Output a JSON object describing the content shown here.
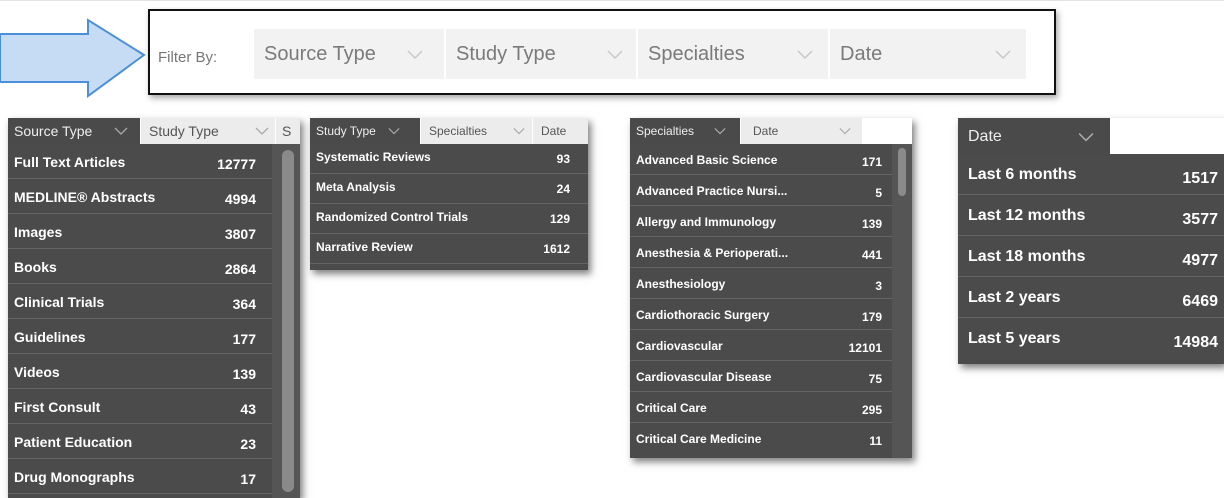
{
  "filter_bar": {
    "label": "Filter By:",
    "dropdowns": [
      {
        "label": "Source Type"
      },
      {
        "label": "Study Type"
      },
      {
        "label": "Specialties"
      },
      {
        "label": "Date"
      }
    ]
  },
  "source_panel": {
    "tabs": [
      "Source Type",
      "Study Type",
      "S"
    ],
    "items": [
      {
        "label": "Full Text Articles",
        "count": "12777"
      },
      {
        "label": "MEDLINE® Abstracts",
        "count": "4994"
      },
      {
        "label": "Images",
        "count": "3807"
      },
      {
        "label": "Books",
        "count": "2864"
      },
      {
        "label": "Clinical Trials",
        "count": "364"
      },
      {
        "label": "Guidelines",
        "count": "177"
      },
      {
        "label": "Videos",
        "count": "139"
      },
      {
        "label": "First Consult",
        "count": "43"
      },
      {
        "label": "Patient Education",
        "count": "23"
      },
      {
        "label": "Drug Monographs",
        "count": "17"
      }
    ]
  },
  "study_panel": {
    "tabs": [
      "Study Type",
      "Specialties",
      "Date"
    ],
    "items": [
      {
        "label": "Systematic Reviews",
        "count": "93"
      },
      {
        "label": "Meta Analysis",
        "count": "24"
      },
      {
        "label": "Randomized Control Trials",
        "count": "129"
      },
      {
        "label": "Narrative Review",
        "count": "1612"
      }
    ]
  },
  "specialties_panel": {
    "tabs": [
      "Specialties",
      "Date"
    ],
    "items": [
      {
        "label": "Advanced Basic Science",
        "count": "171"
      },
      {
        "label": "Advanced Practice Nursi...",
        "count": "5"
      },
      {
        "label": "Allergy and Immunology",
        "count": "139"
      },
      {
        "label": "Anesthesia & Perioperati...",
        "count": "441"
      },
      {
        "label": "Anesthesiology",
        "count": "3"
      },
      {
        "label": "Cardiothoracic Surgery",
        "count": "179"
      },
      {
        "label": "Cardiovascular",
        "count": "12101"
      },
      {
        "label": "Cardiovascular Disease",
        "count": "75"
      },
      {
        "label": "Critical Care",
        "count": "295"
      },
      {
        "label": "Critical Care Medicine",
        "count": "11"
      }
    ]
  },
  "date_panel": {
    "tabs": [
      "Date"
    ],
    "items": [
      {
        "label": "Last 6 months",
        "count": "1517"
      },
      {
        "label": "Last 12 months",
        "count": "3577"
      },
      {
        "label": "Last 18 months",
        "count": "4977"
      },
      {
        "label": "Last 2 years",
        "count": "6469"
      },
      {
        "label": "Last 5 years",
        "count": "14984"
      }
    ]
  },
  "colors": {
    "panel_bg": "#4b4b4b",
    "active_tab": "#4a4a4a",
    "inactive_tab": "#ececec",
    "callout": "#bcd6f2",
    "callout_border": "#4a8fd8"
  }
}
